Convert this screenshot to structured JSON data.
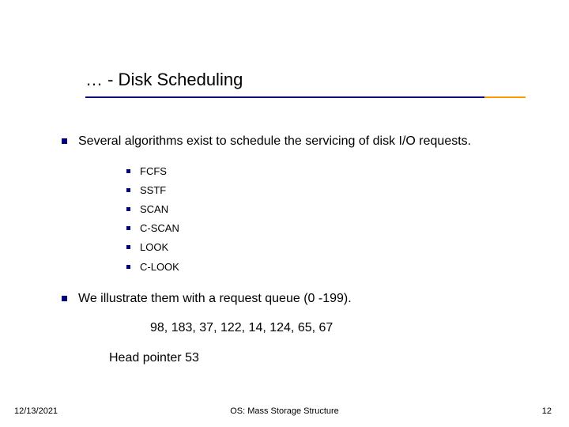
{
  "title": "… - Disk Scheduling",
  "bullets": {
    "intro": "Several algorithms exist to schedule the servicing of disk I/O requests.",
    "algorithms": [
      "FCFS",
      "SSTF",
      "SCAN",
      "C-SCAN",
      "LOOK",
      "C-LOOK"
    ],
    "illustrate": "We illustrate them with a request queue (0 -199).",
    "queue": "98, 183, 37, 122, 14, 124, 65, 67",
    "head": "Head pointer 53"
  },
  "footer": {
    "date": "12/13/2021",
    "center": "OS: Mass Storage Structure",
    "page": "12"
  }
}
